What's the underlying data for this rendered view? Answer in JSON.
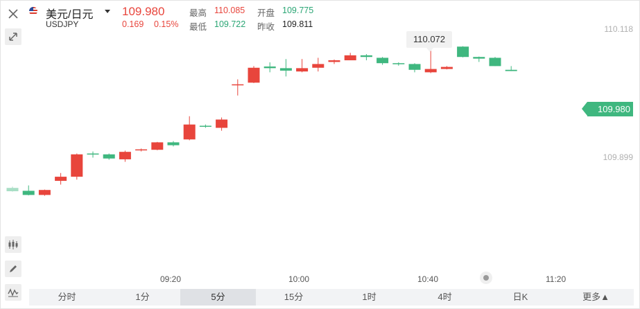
{
  "header": {
    "title": "美元/日元",
    "symbol": "USDJPY",
    "price": "109.980",
    "change": "0.169",
    "change_pct": "0.15%",
    "high_label": "最高",
    "high": "110.085",
    "open_label": "开盘",
    "open": "109.775",
    "low_label": "最低",
    "low": "109.722",
    "prev_close_label": "昨收",
    "prev_close": "109.811"
  },
  "tools": {
    "close": "close-icon",
    "expand": "expand-icon",
    "candles": "candlestick-icon",
    "pen": "pencil-icon",
    "indicator": "wave-icon"
  },
  "tabs": [
    "分时",
    "1分",
    "5分",
    "15分",
    "1时",
    "4时",
    "日K",
    "更多▲"
  ],
  "active_tab": "5分",
  "colors": {
    "up": "#e8453c",
    "down": "#3fb77f",
    "text_up": "#e8453c",
    "text_down": "#2ba675"
  },
  "chart_data": {
    "type": "candlestick",
    "ylim": [
      109.62,
      110.14
    ],
    "y_tick_labels": [
      "110.118",
      "109.899"
    ],
    "y_ticks": [
      110.118,
      109.899
    ],
    "x_tick_labels": [
      "09:20",
      "10:00",
      "10:40",
      "11:20"
    ],
    "x_ticks": [
      9.5,
      17.5,
      25.5,
      33.5
    ],
    "current_price_label": "109.980",
    "current_price": 109.98,
    "max_annotation": "110.072",
    "max_annotation_index": 26,
    "candles": [
      {
        "i": 0,
        "o": 109.735,
        "h": 109.738,
        "l": 109.726,
        "c": 109.727,
        "faded": true
      },
      {
        "i": 1,
        "o": 109.728,
        "h": 109.741,
        "l": 109.717,
        "c": 109.718
      },
      {
        "i": 2,
        "o": 109.718,
        "h": 109.731,
        "l": 109.716,
        "c": 109.73
      },
      {
        "i": 3,
        "o": 109.752,
        "h": 109.771,
        "l": 109.743,
        "c": 109.762
      },
      {
        "i": 4,
        "o": 109.762,
        "h": 109.818,
        "l": 109.755,
        "c": 109.816
      },
      {
        "i": 5,
        "o": 109.818,
        "h": 109.823,
        "l": 109.808,
        "c": 109.816
      },
      {
        "i": 6,
        "o": 109.816,
        "h": 109.818,
        "l": 109.803,
        "c": 109.806
      },
      {
        "i": 7,
        "o": 109.804,
        "h": 109.825,
        "l": 109.798,
        "c": 109.822
      },
      {
        "i": 8,
        "o": 109.826,
        "h": 109.83,
        "l": 109.823,
        "c": 109.828
      },
      {
        "i": 9,
        "o": 109.827,
        "h": 109.846,
        "l": 109.826,
        "c": 109.845
      },
      {
        "i": 10,
        "o": 109.845,
        "h": 109.848,
        "l": 109.835,
        "c": 109.838
      },
      {
        "i": 11,
        "o": 109.852,
        "h": 109.908,
        "l": 109.85,
        "c": 109.888
      },
      {
        "i": 12,
        "o": 109.885,
        "h": 109.888,
        "l": 109.88,
        "c": 109.883
      },
      {
        "i": 13,
        "o": 109.88,
        "h": 109.905,
        "l": 109.873,
        "c": 109.9
      },
      {
        "i": 14,
        "o": 109.985,
        "h": 109.997,
        "l": 109.958,
        "c": 109.985
      },
      {
        "i": 15,
        "o": 109.989,
        "h": 110.029,
        "l": 109.988,
        "c": 110.025
      },
      {
        "i": 16,
        "o": 110.028,
        "h": 110.038,
        "l": 110.014,
        "c": 110.024
      },
      {
        "i": 17,
        "o": 110.024,
        "h": 110.046,
        "l": 110.004,
        "c": 110.018
      },
      {
        "i": 18,
        "o": 110.016,
        "h": 110.046,
        "l": 110.014,
        "c": 110.024
      },
      {
        "i": 19,
        "o": 110.025,
        "h": 110.049,
        "l": 110.016,
        "c": 110.034
      },
      {
        "i": 20,
        "o": 110.039,
        "h": 110.045,
        "l": 110.034,
        "c": 110.043
      },
      {
        "i": 21,
        "o": 110.043,
        "h": 110.061,
        "l": 110.043,
        "c": 110.055
      },
      {
        "i": 22,
        "o": 110.055,
        "h": 110.058,
        "l": 110.043,
        "c": 110.051
      },
      {
        "i": 23,
        "o": 110.049,
        "h": 110.051,
        "l": 110.032,
        "c": 110.036
      },
      {
        "i": 24,
        "o": 110.036,
        "h": 110.038,
        "l": 110.03,
        "c": 110.034
      },
      {
        "i": 25,
        "o": 110.034,
        "h": 110.036,
        "l": 110.014,
        "c": 110.02
      },
      {
        "i": 26,
        "o": 110.014,
        "h": 110.072,
        "l": 110.012,
        "c": 110.022
      },
      {
        "i": 27,
        "o": 110.022,
        "h": 110.029,
        "l": 110.021,
        "c": 110.027
      },
      {
        "i": 28,
        "o": 110.076,
        "h": 110.077,
        "l": 110.05,
        "c": 110.051
      },
      {
        "i": 29,
        "o": 110.051,
        "h": 110.052,
        "l": 110.039,
        "c": 110.047
      },
      {
        "i": 30,
        "o": 110.049,
        "h": 110.051,
        "l": 110.029,
        "c": 110.029
      },
      {
        "i": 31,
        "o": 110.02,
        "h": 110.029,
        "l": 110.017,
        "c": 110.017
      }
    ]
  }
}
